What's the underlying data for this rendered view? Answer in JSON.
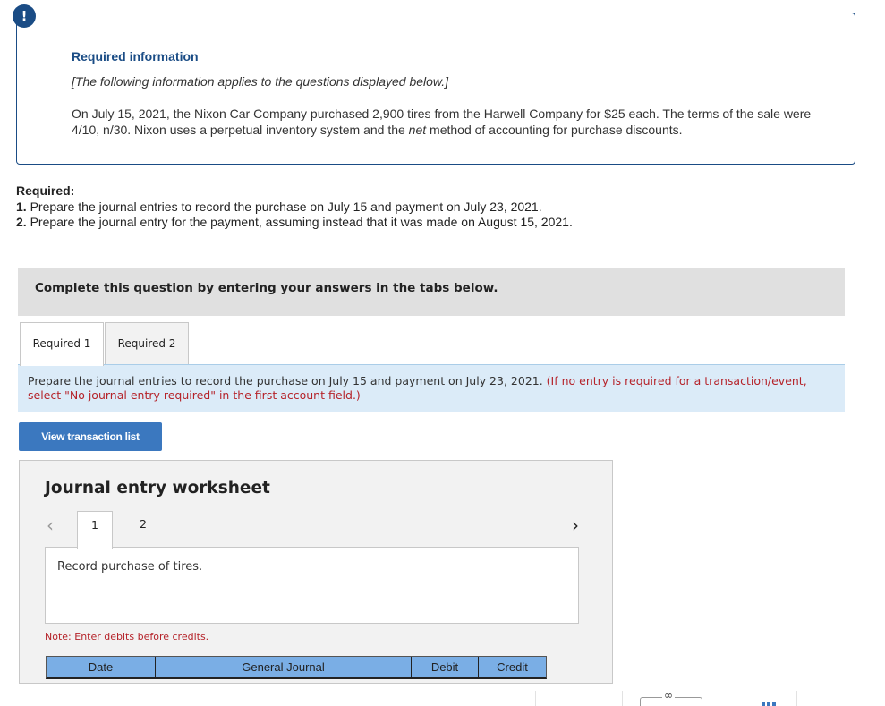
{
  "info": {
    "badge": "!",
    "title": "Required information",
    "subtitle": "[The following information applies to the questions displayed below.]",
    "body_part1": "On July 15, 2021, the Nixon Car Company purchased 2,900 tires from the Harwell Company for $25 each. The terms of the sale were 4/10, n/30. Nixon uses a perpetual inventory system and the ",
    "body_italic": "net",
    "body_part2": " method of accounting for purchase discounts."
  },
  "required": {
    "heading": "Required:",
    "items": [
      {
        "num": "1.",
        "text": " Prepare the journal entries to record the purchase on July 15 and payment on July 23, 2021."
      },
      {
        "num": "2.",
        "text": " Prepare the journal entry for the payment, assuming instead that it was made on August 15, 2021."
      }
    ]
  },
  "complete_bar": "Complete this question by entering your answers in the tabs below.",
  "tabs": [
    {
      "label": "Required 1",
      "active": true
    },
    {
      "label": "Required 2",
      "active": false
    }
  ],
  "instructions": {
    "main": "Prepare the journal entries to record the purchase on July 15 and payment on July 23, 2021. ",
    "red": "(If no entry is required for a transaction/event, select \"No journal entry required\" in the first account field.)"
  },
  "view_button": "View transaction list",
  "worksheet": {
    "title": "Journal entry worksheet",
    "prev_icon": "‹",
    "next_icon": "›",
    "entry_tabs": [
      "1",
      "2"
    ],
    "active_entry": "1",
    "description": "Record purchase of tires.",
    "note": "Note: Enter debits before credits.",
    "columns": [
      "Date",
      "General Journal",
      "Debit",
      "Credit"
    ]
  },
  "colors": {
    "brand_navy": "#1a4c85",
    "button_blue": "#3b78bf",
    "table_header": "#7aaee5",
    "alert_red": "#b5232a"
  }
}
